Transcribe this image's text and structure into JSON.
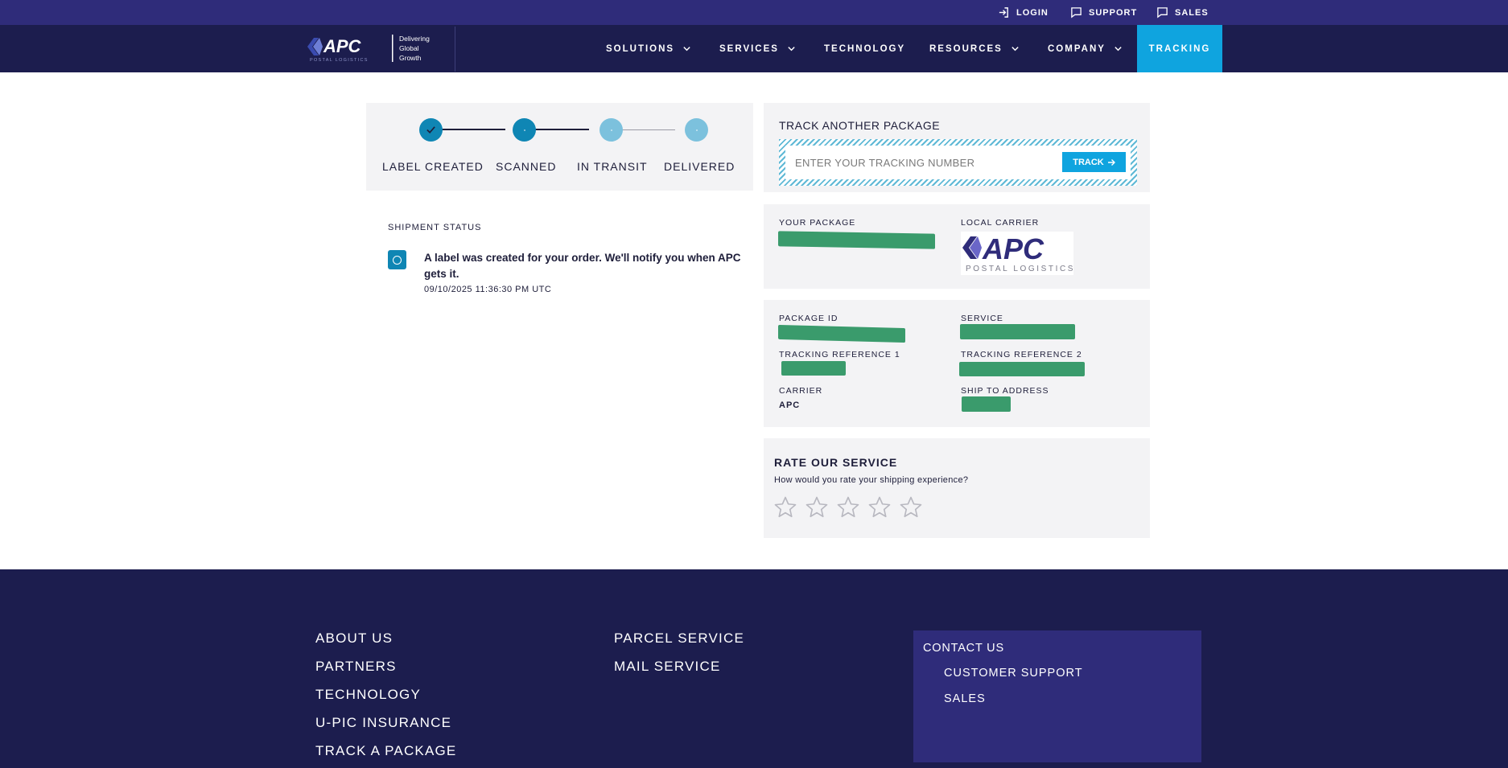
{
  "util_bar": {
    "items": [
      {
        "label": "LOGIN",
        "icon": "login-icon"
      },
      {
        "label": "SUPPORT",
        "icon": "chat-icon"
      },
      {
        "label": "SALES",
        "icon": "chat-icon"
      }
    ]
  },
  "brand": {
    "logo_text": "APC",
    "logo_sub": "POSTAL LOGISTICS",
    "tagline": [
      "Delivering",
      "Global",
      "Growth"
    ]
  },
  "nav": {
    "items": [
      {
        "label": "SOLUTIONS",
        "has_dropdown": true
      },
      {
        "label": "SERVICES",
        "has_dropdown": true
      },
      {
        "label": "TECHNOLOGY",
        "has_dropdown": false
      },
      {
        "label": "RESOURCES",
        "has_dropdown": true
      },
      {
        "label": "COMPANY",
        "has_dropdown": true
      }
    ],
    "active": "TRACKING"
  },
  "progress": {
    "steps": [
      {
        "label": "LABEL CREATED",
        "state": "done"
      },
      {
        "label": "SCANNED",
        "state": "done"
      },
      {
        "label": "IN TRANSIT",
        "state": "pending"
      },
      {
        "label": "DELIVERED",
        "state": "pending"
      }
    ]
  },
  "shipment": {
    "title": "SHIPMENT STATUS",
    "events": [
      {
        "message": "A label was created for your order. We'll notify you when APC gets it.",
        "timestamp": "09/10/2025 11:36:30 PM UTC"
      }
    ]
  },
  "track_another": {
    "title": "TRACK ANOTHER PACKAGE",
    "placeholder": "ENTER YOUR TRACKING NUMBER",
    "button_label": "TRACK"
  },
  "package_card": {
    "your_package_label": "YOUR PACKAGE",
    "local_carrier_label": "LOCAL CARRIER",
    "carrier_logo_text": "APC",
    "carrier_logo_sub": "POSTAL LOGISTICS"
  },
  "details": {
    "package_id_label": "PACKAGE ID",
    "service_label": "SERVICE",
    "tracking_ref1_label": "TRACKING REFERENCE 1",
    "tracking_ref2_label": "TRACKING REFERENCE 2",
    "carrier_label": "CARRIER",
    "carrier_value": "APC",
    "ship_to_label": "SHIP TO ADDRESS"
  },
  "rating": {
    "title": "RATE OUR SERVICE",
    "question": "How would you rate your shipping experience?",
    "max_stars": 5,
    "selected": 0
  },
  "footer": {
    "col1": [
      "ABOUT US",
      "PARTNERS",
      "TECHNOLOGY",
      "U-PIC INSURANCE",
      "TRACK A PACKAGE"
    ],
    "col2": [
      "PARCEL SERVICE",
      "MAIL SERVICE"
    ],
    "contact": {
      "title": "CONTACT US",
      "items": [
        "CUSTOMER SUPPORT",
        "SALES"
      ]
    }
  },
  "colors": {
    "util_bar": "#2f2c7a",
    "nav_bar": "#1c1d4e",
    "accent": "#0fa4df",
    "step_done": "#0f86b4",
    "step_pending": "#7cc1dd",
    "redaction": "#3a9b6c",
    "card_bg": "#f3f3f5"
  }
}
